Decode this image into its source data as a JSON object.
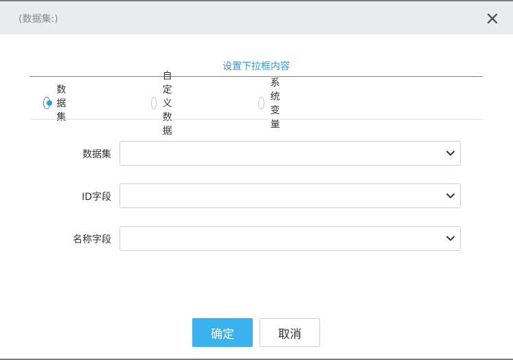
{
  "dialog": {
    "title": "(数据集:)"
  },
  "section": {
    "title": "设置下拉框内容"
  },
  "radios": [
    {
      "label": "数据集",
      "checked": true
    },
    {
      "label": "自定义数据",
      "checked": false
    },
    {
      "label": "系统变量",
      "checked": false
    }
  ],
  "form": {
    "fields": [
      {
        "label": "数据集",
        "value": ""
      },
      {
        "label": "ID字段",
        "value": ""
      },
      {
        "label": "名称字段",
        "value": ""
      }
    ]
  },
  "buttons": {
    "ok_label": "确定",
    "cancel_label": "取消"
  },
  "colors": {
    "accent": "#2e9ad8",
    "primary_button": "#3bb1ee"
  },
  "icons": {
    "close": "close-icon",
    "dropdown": "chevron-down-icon"
  }
}
